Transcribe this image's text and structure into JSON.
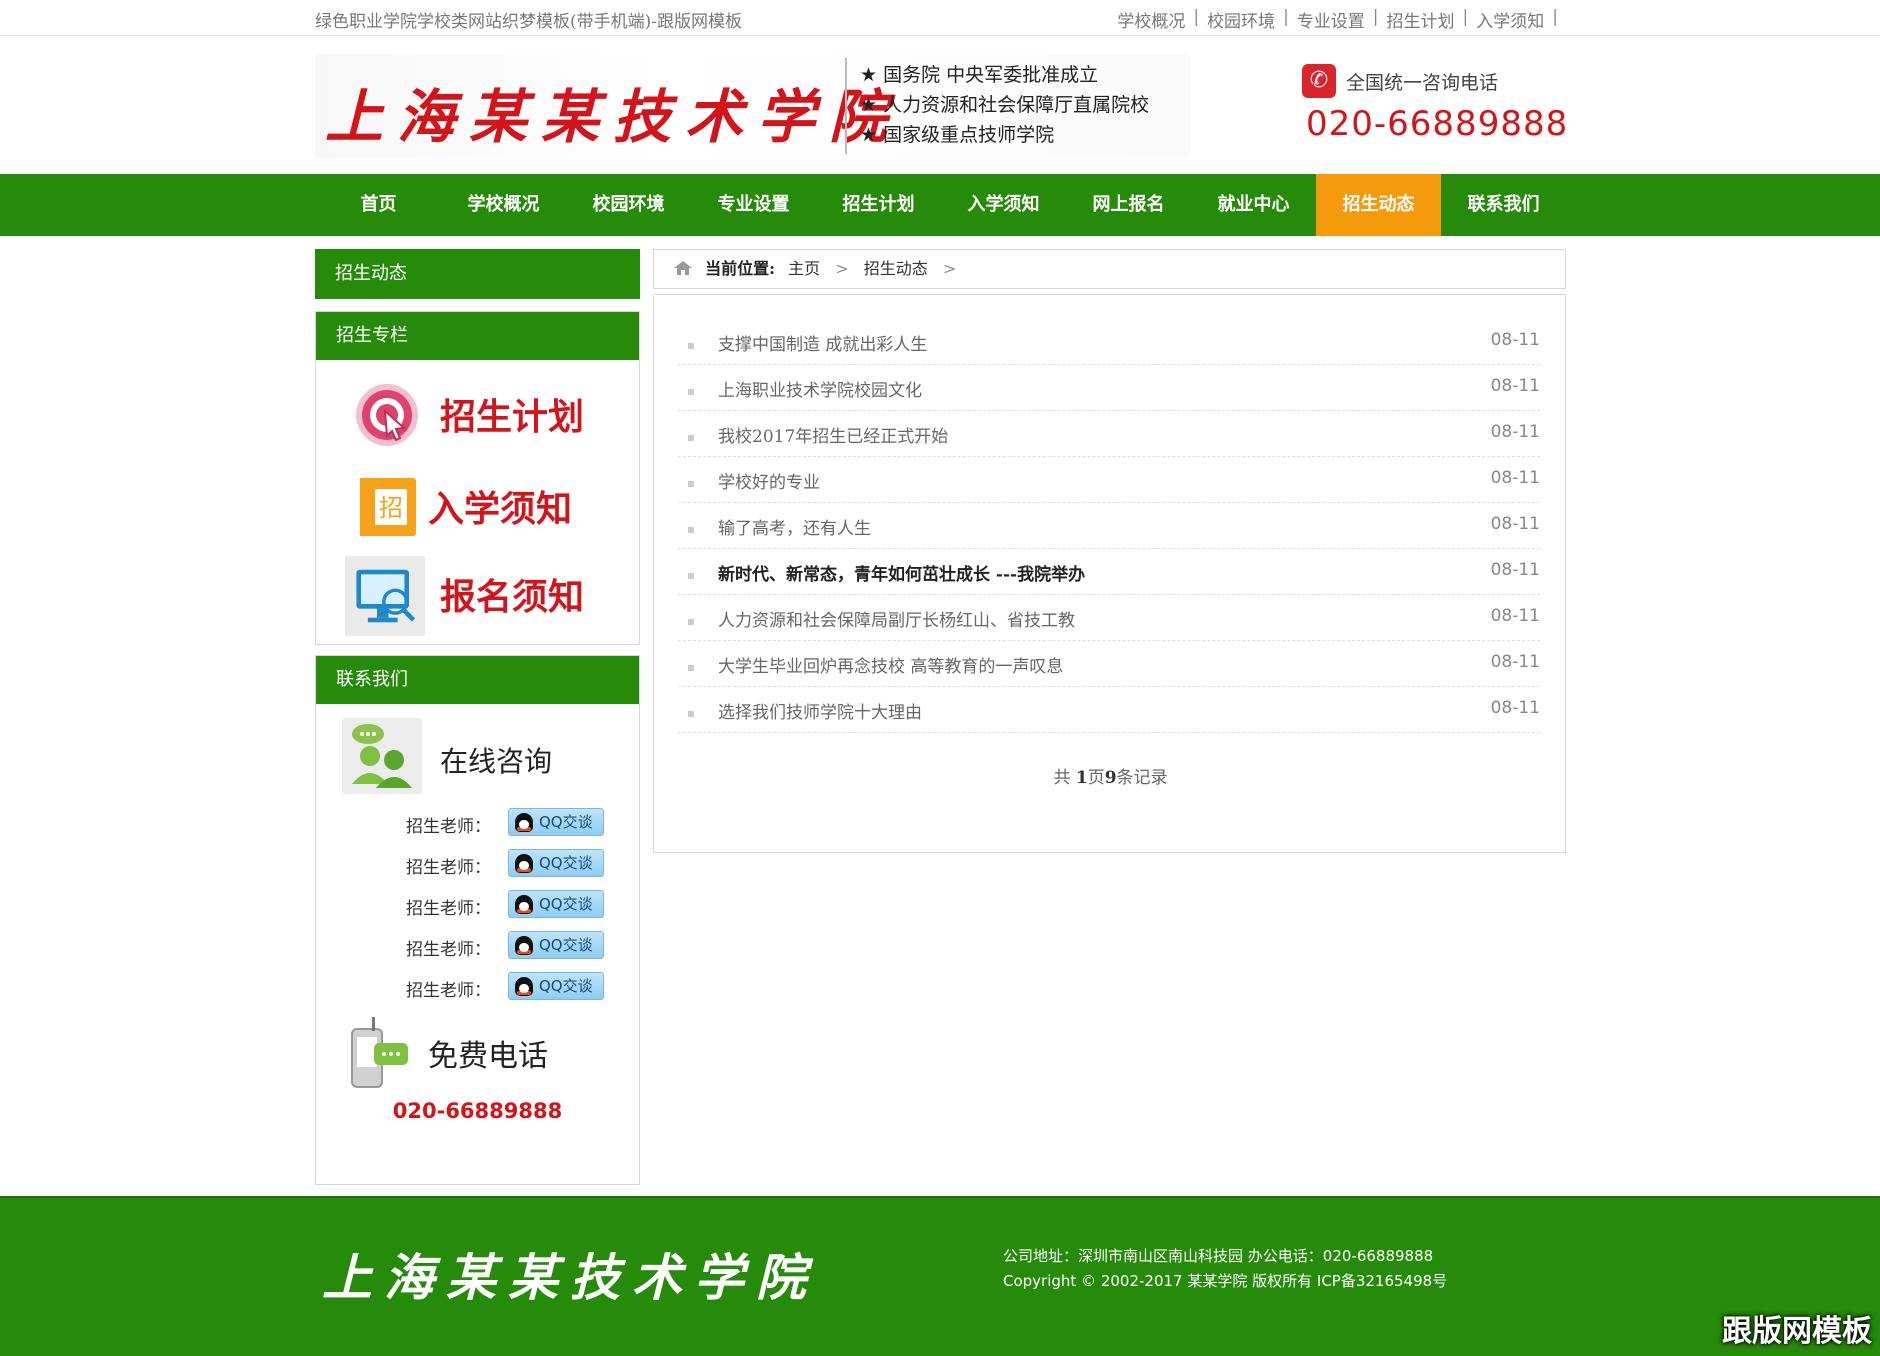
{
  "topbar": {
    "site_title": "绿色职业学院学校类网站织梦模板(带手机端)-跟版网模板",
    "links": [
      "学校概况",
      "校园环境",
      "专业设置",
      "招生计划",
      "入学须知"
    ],
    "separator": "|"
  },
  "header": {
    "logo_text": "上海某某技术学院",
    "bullets": [
      "★ 国务院 中央军委批准成立",
      "★ 人力资源和社会保障厅直属院校",
      "★ 国家级重点技师学院"
    ],
    "hotline_label": "全国统一咨询电话",
    "hotline_number": "020-66889888"
  },
  "nav": {
    "items": [
      "首页",
      "学校概况",
      "校园环境",
      "专业设置",
      "招生计划",
      "入学须知",
      "网上报名",
      "就业中心",
      "招生动态",
      "联系我们"
    ],
    "active": "招生动态"
  },
  "sidebar": {
    "category_title": "招生动态",
    "promo_title": "招生专栏",
    "promos": [
      "招生计划",
      "入学须知",
      "报名须知"
    ],
    "contact_title": "联系我们",
    "consult_label": "在线咨询",
    "qq_rows": [
      {
        "label": "招生老师：",
        "button": "QQ交谈"
      },
      {
        "label": "招生老师：",
        "button": "QQ交谈"
      },
      {
        "label": "招生老师：",
        "button": "QQ交谈"
      },
      {
        "label": "招生老师：",
        "button": "QQ交谈"
      },
      {
        "label": "招生老师：",
        "button": "QQ交谈"
      }
    ],
    "free_call_label": "免费电话",
    "free_call_number": "020-66889888"
  },
  "breadcrumb": {
    "prefix": "当前位置:",
    "items": [
      "主页",
      "招生动态"
    ],
    "separator": ">"
  },
  "news": [
    {
      "title": "支撑中国制造 成就出彩人生",
      "date": "08-11",
      "bold": false
    },
    {
      "title": "上海职业技术学院校园文化",
      "date": "08-11",
      "bold": false
    },
    {
      "title": "我校2017年招生已经正式开始",
      "date": "08-11",
      "bold": false
    },
    {
      "title": "学校好的专业",
      "date": "08-11",
      "bold": false
    },
    {
      "title": "输了高考，还有人生",
      "date": "08-11",
      "bold": false
    },
    {
      "title": "新时代、新常态，青年如何茁壮成长 ---我院举办",
      "date": "08-11",
      "bold": true
    },
    {
      "title": "人力资源和社会保障局副厅长杨红山、省技工教",
      "date": "08-11",
      "bold": false
    },
    {
      "title": "大学生毕业回炉再念技校 高等教育的一声叹息",
      "date": "08-11",
      "bold": false
    },
    {
      "title": "选择我们技师学院十大理由",
      "date": "08-11",
      "bold": false
    }
  ],
  "pager": {
    "pre": "共",
    "pages": "1",
    "mid": "页",
    "records": "9",
    "post": "条记录"
  },
  "footer": {
    "logo_text": "上海某某技术学院",
    "address_line": "公司地址：深圳市南山区南山科技园  办公电话：020-66889888",
    "copyright_line": "Copyright © 2002-2017 某某学院 版权所有  ICP备32165498号",
    "watermark": "跟版网模板"
  },
  "colors": {
    "brand_green": "#268a0a",
    "active_orange": "#f59b0b",
    "accent_red": "#d4141b"
  }
}
